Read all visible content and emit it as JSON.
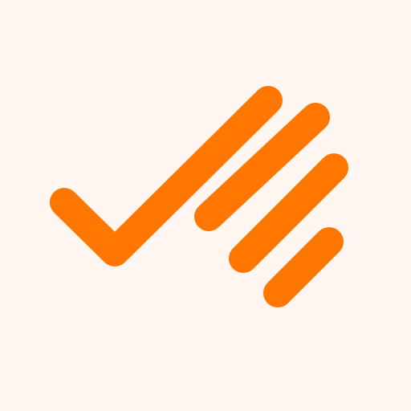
{
  "app": {
    "icon": "checkmark-with-speed-lines-icon"
  },
  "colors": {
    "background": "#FFF6F1",
    "accent": "#FF7600"
  }
}
